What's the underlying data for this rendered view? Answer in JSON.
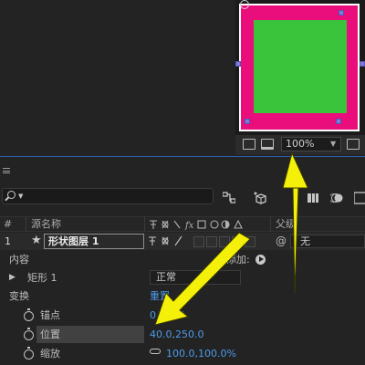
{
  "viewer": {
    "zoom_value": "100%",
    "zoom_chevron": "chevron-down-icon",
    "icons": [
      "snapshot-icon",
      "monitor-icon",
      "region-icon"
    ]
  },
  "timeline": {
    "columns": {
      "number": "#",
      "source_name": "源名称",
      "parent": "父级"
    },
    "layer": {
      "index": "1",
      "name": "形状图层 1",
      "parent_value": "无"
    },
    "rows": {
      "contents_label": "内容",
      "add_label": "添加:",
      "rect_label": "矩形 1",
      "mode_value": "正常",
      "transform_label": "变换",
      "reset_label": "重置",
      "anchor_label": "锚点",
      "anchor_value": "0.0,0.0",
      "position_label": "位置",
      "position_value": "40.0,250.0",
      "scale_label": "缩放",
      "scale_value": "100.0,100.0%"
    }
  },
  "colors": {
    "accent_blue": "#4c9be8",
    "layer_fill": "#39c43c",
    "layer_stroke": "#ea0e7c",
    "arrow": "#f5f00a"
  }
}
